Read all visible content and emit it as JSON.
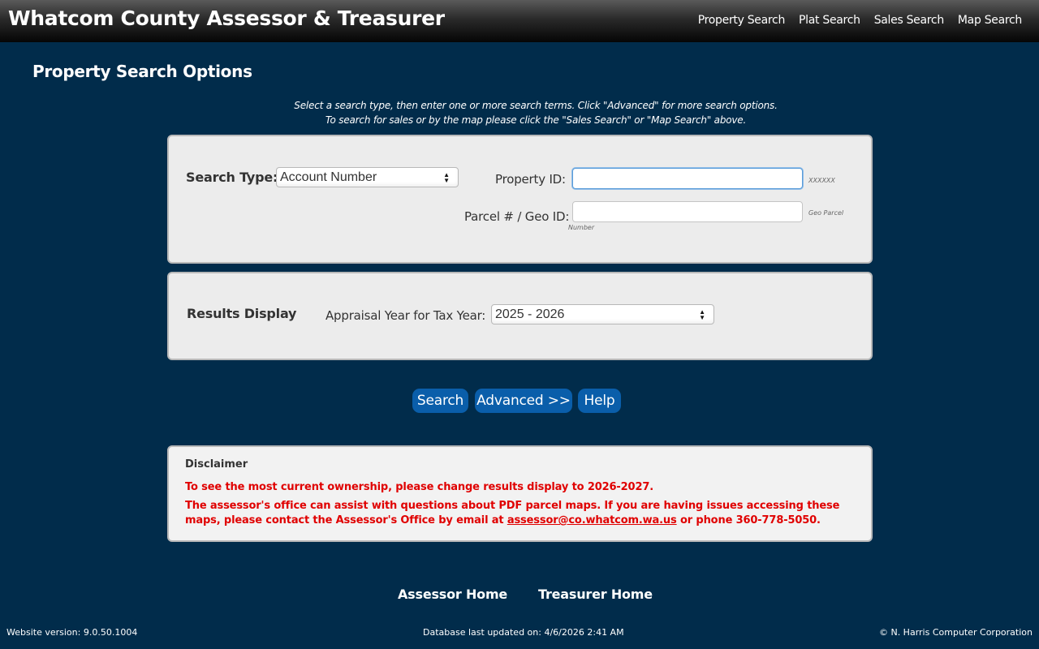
{
  "header": {
    "title": "Whatcom County Assessor & Treasurer",
    "nav": [
      "Property Search",
      "Plat Search",
      "Sales Search",
      "Map Search"
    ]
  },
  "page_title": "Property Search Options",
  "intro": {
    "line1": "Select a search type, then enter one or more search terms. Click \"Advanced\" for more search options.",
    "line2": "To search for sales or by the map please click the \"Sales Search\" or \"Map Search\" above."
  },
  "search_panel": {
    "search_type_label": "Search Type:",
    "search_type_value": "Account Number",
    "property_id_label": "Property ID:",
    "property_id_value": "",
    "property_id_hint": "XXXXXX",
    "parcel_label": "Parcel # / Geo ID:",
    "parcel_value": "",
    "parcel_hint_1": "Geo Parcel",
    "parcel_hint_2": "Number"
  },
  "results_panel": {
    "title": "Results Display",
    "year_label": "Appraisal Year for Tax Year:",
    "year_value": "2025 - 2026"
  },
  "buttons": {
    "search": "Search",
    "advanced": "Advanced >>",
    "help": "Help"
  },
  "disclaimer": {
    "title": "Disclaimer",
    "line1": "To see the most current ownership, please change results display to 2026-2027.",
    "line2_pre": "The assessor's office can assist with questions about PDF parcel maps. If you are having issues accessing these maps, please contact the Assessor's Office by email at ",
    "email": "assessor@co.whatcom.wa.us",
    "line2_post": " or phone 360-778-5050."
  },
  "links": {
    "assessor_home": "Assessor Home",
    "treasurer_home": "Treasurer Home"
  },
  "footer": {
    "version": "Website version: 9.0.50.1004",
    "db_updated": "Database last updated on: 4/6/2026 2:41 AM",
    "copyright": "© N. Harris Computer Corporation"
  }
}
